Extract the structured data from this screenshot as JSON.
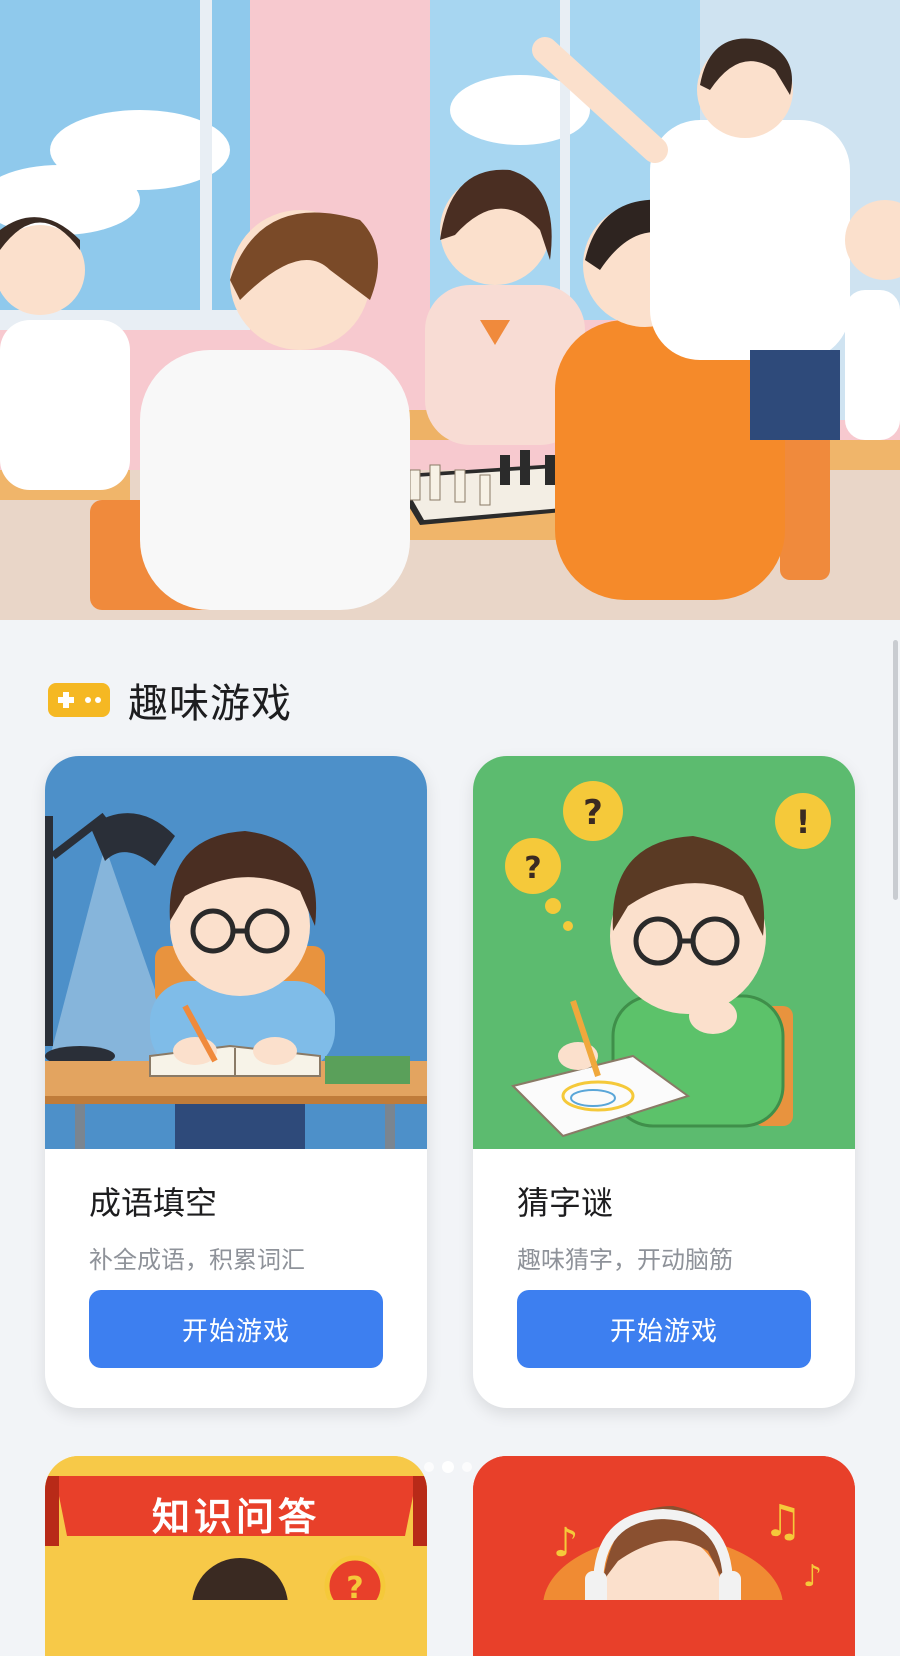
{
  "section": {
    "title": "趣味游戏",
    "icon": "gamepad-icon",
    "accent": "#f5b823"
  },
  "games": [
    {
      "title": "成语填空",
      "description": "补全成语，积累词汇",
      "button": "开始游戏",
      "bg": "#4d90c9"
    },
    {
      "title": "猜字谜",
      "description": "趣味猜字，开动脑筋",
      "button": "开始游戏",
      "bg": "#5cbb6f"
    }
  ],
  "partial_cards": [
    {
      "banner_text": "知识问答",
      "bg": "#f7c948"
    },
    {
      "bg": "#e8402a"
    }
  ],
  "colors": {
    "button": "#3d7ff0",
    "page_bg": "#f2f4f7",
    "card_bg": "#ffffff"
  },
  "carousel": {
    "page_count": 3,
    "active_index": 1
  }
}
